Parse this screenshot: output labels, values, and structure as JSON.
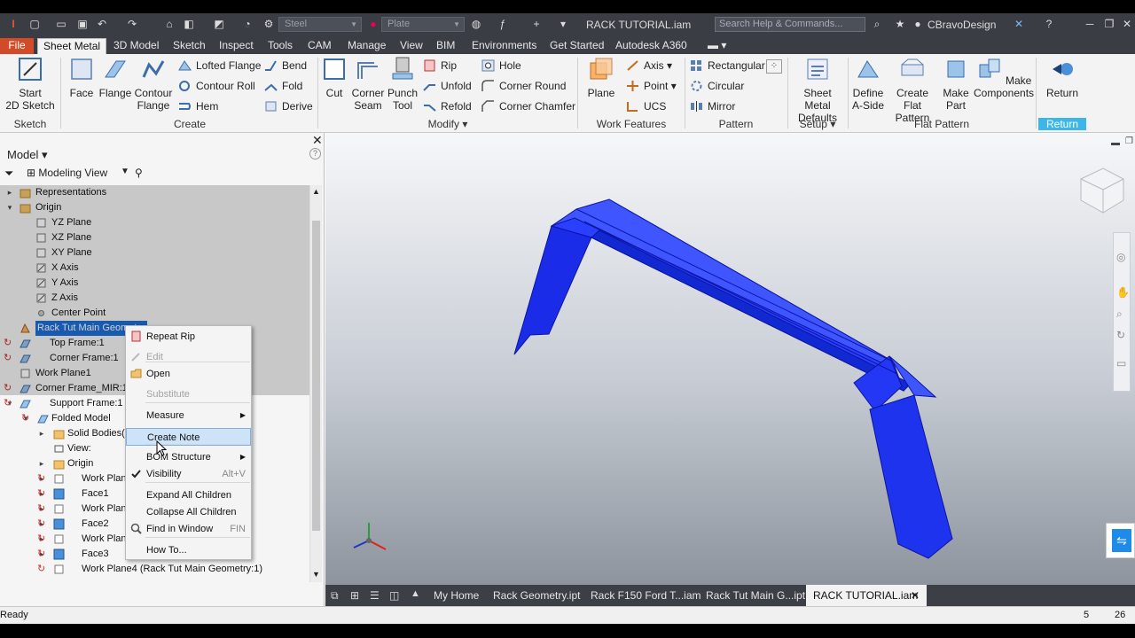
{
  "titlebar": {
    "material": "Steel",
    "appearance": "Plate",
    "title": "RACK TUTORIAL.iam",
    "search_placeholder": "Search Help & Commands...",
    "user": "CBravoDesign"
  },
  "ribbon_tabs": [
    "File",
    "Sheet Metal",
    "3D Model",
    "Sketch",
    "Inspect",
    "Tools",
    "CAM",
    "Manage",
    "View",
    "BIM",
    "Environments",
    "Get Started",
    "Autodesk A360"
  ],
  "ribbon": {
    "start_sketch": "Start\n2D Sketch",
    "sketch_panel": "Sketch",
    "face": "Face",
    "flange": "Flange",
    "contour_flange": "Contour\nFlange",
    "lofted_flange": "Lofted Flange",
    "contour_roll": "Contour Roll",
    "hem": "Hem",
    "bend": "Bend",
    "fold": "Fold",
    "derive": "Derive",
    "create_panel": "Create",
    "cut": "Cut",
    "corner_seam": "Corner\nSeam",
    "punch_tool": "Punch\nTool",
    "rip": "Rip",
    "unfold": "Unfold",
    "refold": "Refold",
    "hole": "Hole",
    "corner_round": "Corner Round",
    "corner_chamfer": "Corner Chamfer",
    "modify_panel": "Modify",
    "plane": "Plane",
    "axis": "Axis",
    "point": "Point",
    "ucs": "UCS",
    "work_features_panel": "Work Features",
    "rectangular": "Rectangular",
    "circular": "Circular",
    "mirror": "Mirror",
    "pattern_panel": "Pattern",
    "sheet_metal_defaults": "Sheet Metal\nDefaults",
    "setup_panel": "Setup",
    "define_a_side": "Define\nA-Side",
    "create_flat_pattern": "Create\nFlat Pattern",
    "make_part": "Make\nPart",
    "make_components": "Make\nComponents",
    "flat_pattern_panel": "Flat Pattern",
    "return": "Return",
    "return_panel": "Return"
  },
  "browser": {
    "header": "Model",
    "view": "Modeling View",
    "tree": [
      "Representations",
      "Origin",
      "YZ Plane",
      "XZ Plane",
      "XY Plane",
      "X Axis",
      "Y Axis",
      "Z Axis",
      "Center Point",
      "Rack Tut Main Geometry",
      "Top Frame:1",
      "Corner Frame:1",
      "Work Plane1",
      "Corner Frame_MIR:1",
      "Support Frame:1",
      "Folded Model",
      "Solid Bodies(1)",
      "View:",
      "Origin",
      "Work Plane",
      "Face1",
      "Work Plane",
      "Face2",
      "Work Plane",
      "Face3",
      "Work Plane4 (Rack Tut Main Geometry:1)"
    ]
  },
  "context_menu": [
    {
      "label": "Repeat Rip",
      "enabled": true
    },
    {
      "label": "Edit",
      "enabled": false
    },
    {
      "label": "Open",
      "enabled": true
    },
    {
      "label": "Substitute",
      "enabled": false
    },
    {
      "label": "Measure",
      "enabled": true
    },
    {
      "label": "Create Note",
      "enabled": true
    },
    {
      "label": "BOM Structure",
      "enabled": true
    },
    {
      "label": "Visibility",
      "enabled": true,
      "shortcut": "Alt+V"
    },
    {
      "label": "Expand All Children",
      "enabled": true
    },
    {
      "label": "Collapse All Children",
      "enabled": true
    },
    {
      "label": "Find in Window",
      "enabled": true,
      "shortcut": "FIN"
    },
    {
      "label": "How To...",
      "enabled": true
    }
  ],
  "doc_tabs": [
    "My Home",
    "Rack Geometry.ipt",
    "Rack F150 Ford T...iam",
    "Rack Tut Main G...ipt",
    "RACK TUTORIAL.iam"
  ],
  "status": {
    "text": "Ready",
    "count1": "5",
    "count2": "26"
  },
  "colors": {
    "accent": "#d24b28",
    "selection": "#1e6ed6",
    "model": "#1f3fff",
    "return": "#3cb6e8"
  }
}
